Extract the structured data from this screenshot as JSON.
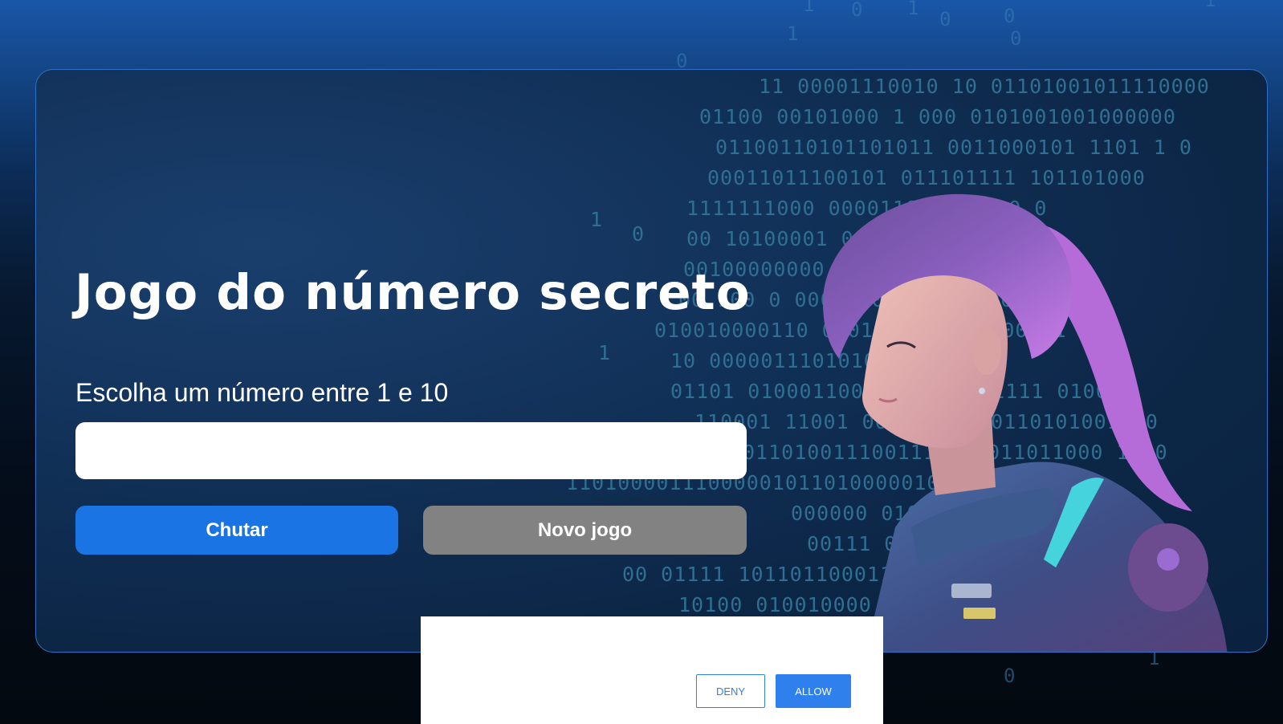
{
  "game": {
    "title": "Jogo do número secreto",
    "prompt": "Escolha um número entre 1 e 10",
    "input_value": "",
    "guess_button": "Chutar",
    "new_game_button": "Novo jogo"
  },
  "permission_dialog": {
    "deny_label": "DENY",
    "allow_label": "ALLOW"
  },
  "background_code_rows": [
    "1    0      1    0      0",
    "1              0",
    "11 00001110010 10 01101001011110000",
    "01100 00101000 1   000 0101001001000000",
    "01100110101101011  0011000101 1101 1  0",
    "00011011100101     011101111  101101000",
    "1111111000      0000110000011 0 0",
    "00 10100001  0  0100101111  0",
    "00100000000  010011101100000",
    "00 100  0  000101011 000100010",
    "010010000110   00010100  0101100001",
    "10 0000011101010001011111",
    "01101 01000110001011101111111 0100",
    "110001 11001 00001010000110101001110",
    "0110100111001110101011011000 1010",
    "110100001110000010110100000100100010",
    "000000  0101001000000 00001",
    "00111  001010010001000",
    "00 01111  101101100011101 11011",
    "10100 010010000 0000001100 1010"
  ],
  "colors": {
    "card_border": "#2e71c7",
    "primary_button": "#1b74e4",
    "secondary_button": "#828282",
    "dialog_accent": "#2f80ed"
  }
}
